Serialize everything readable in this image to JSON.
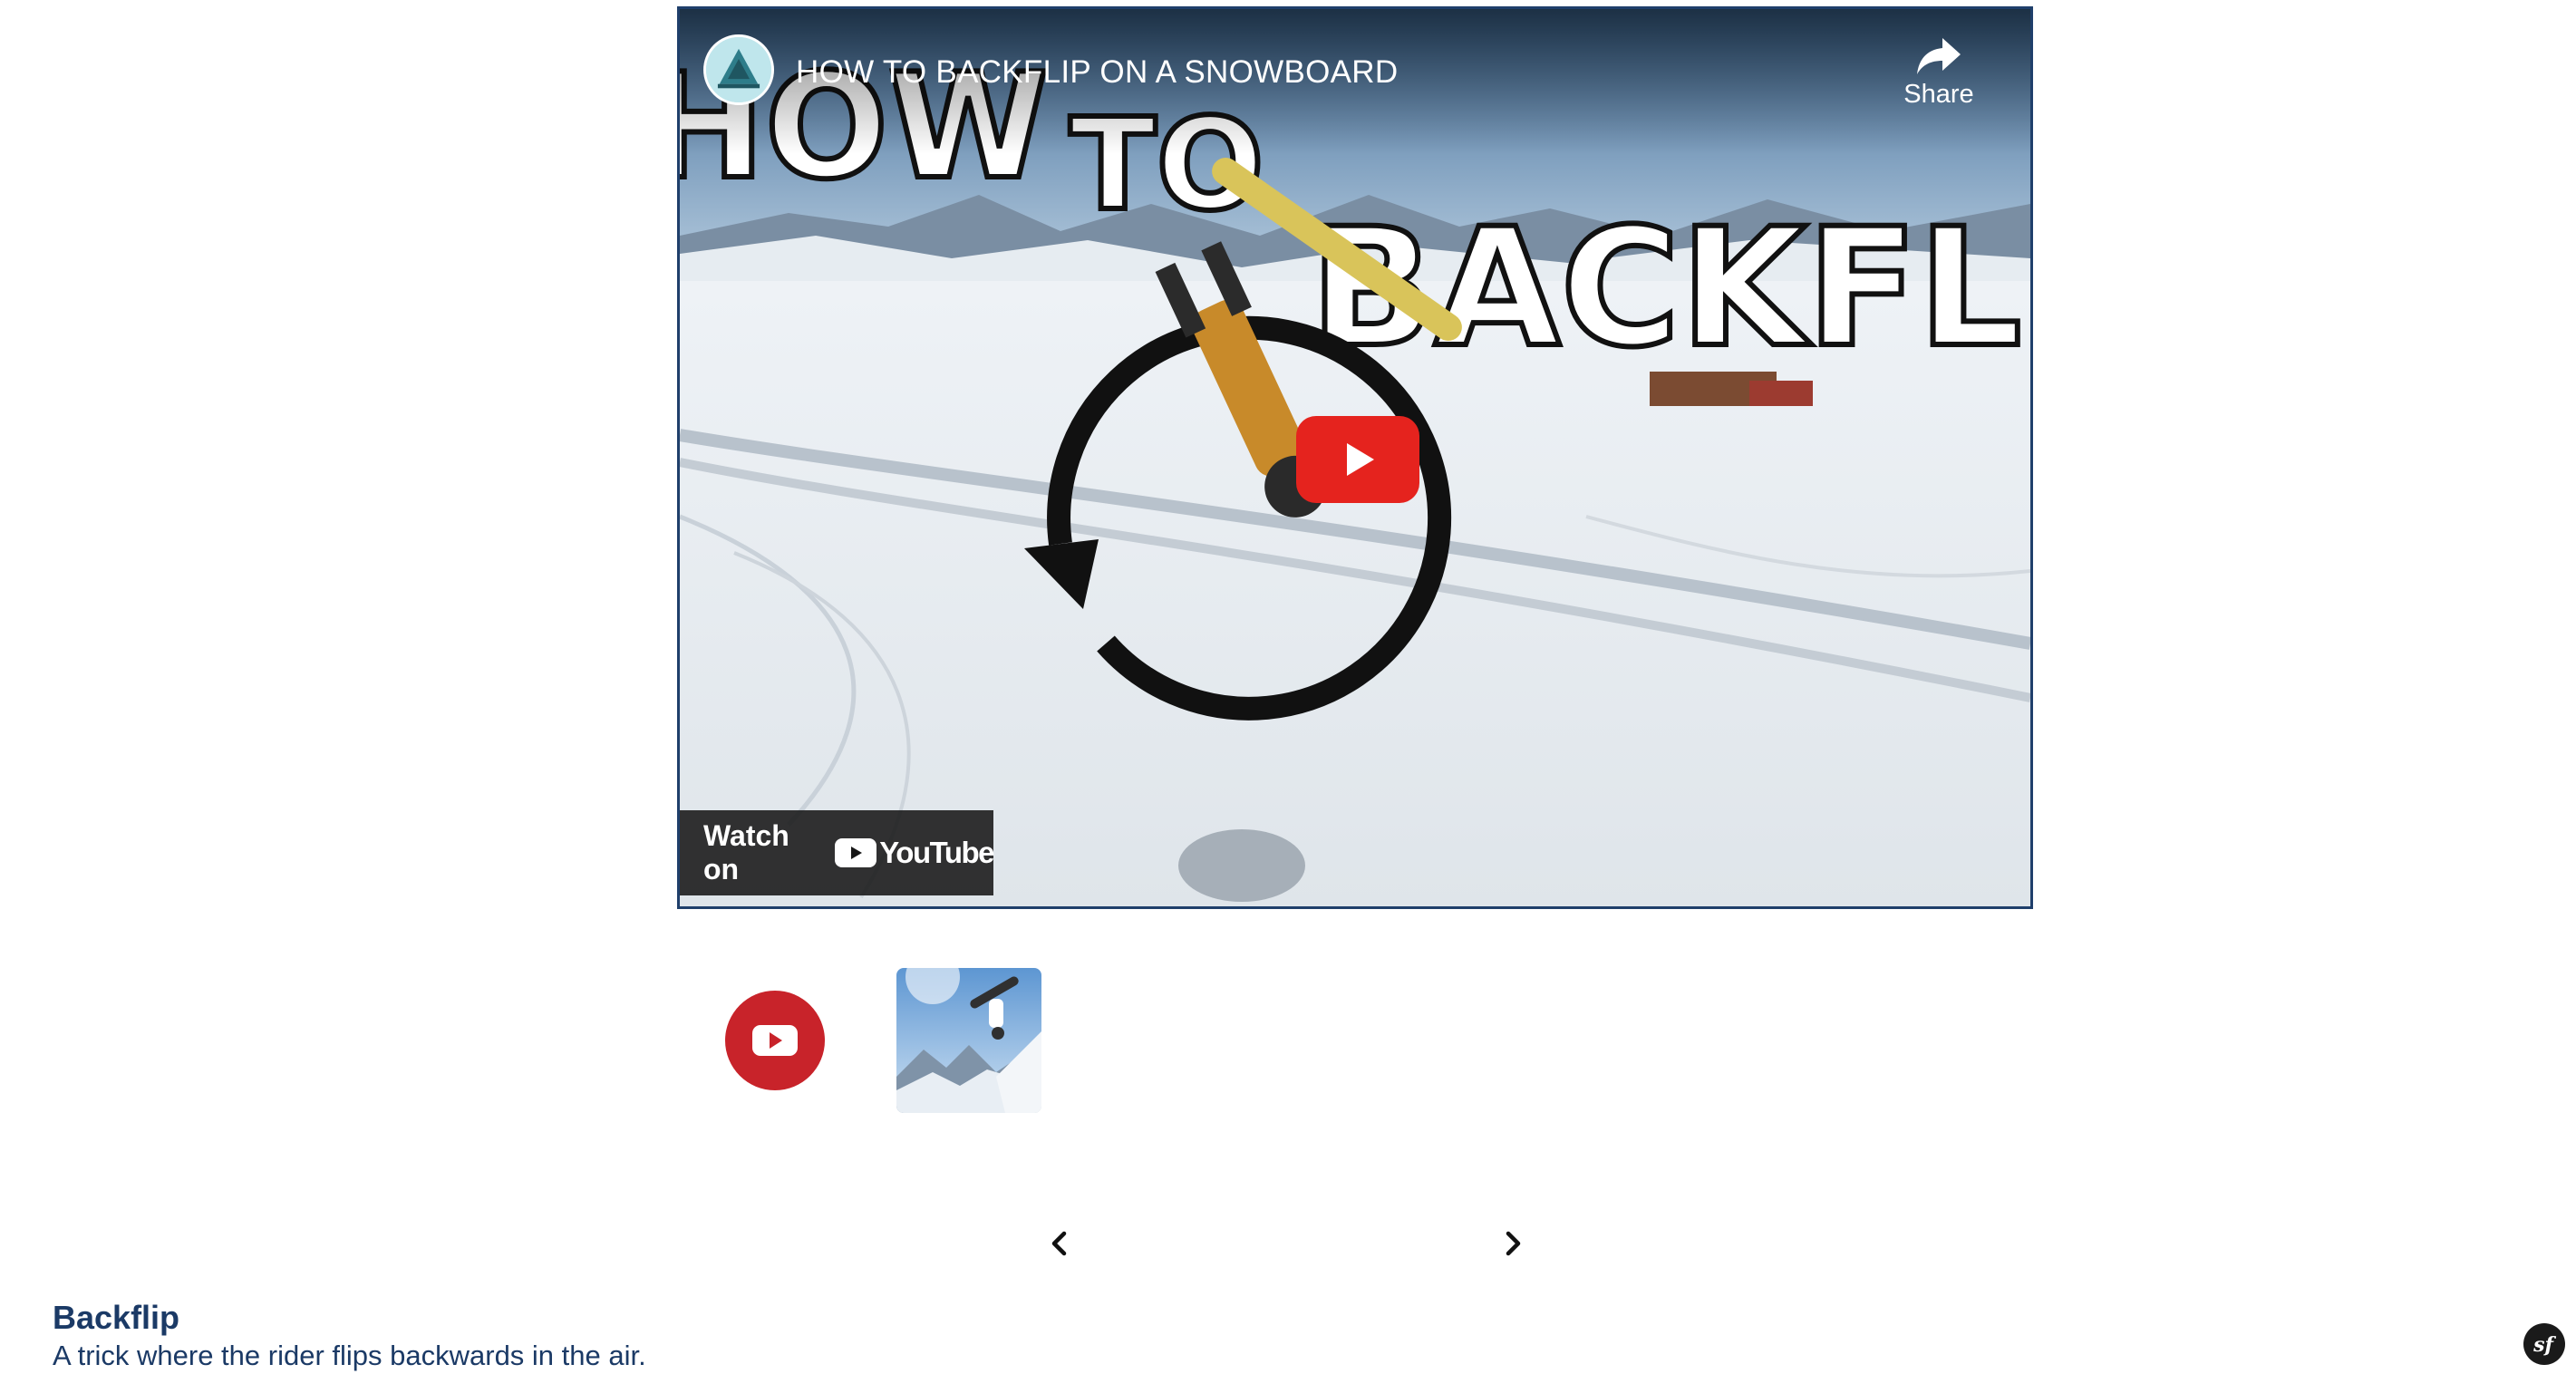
{
  "video": {
    "title": "HOW TO BACKFLIP ON A SNOWBOARD",
    "share_label": "Share",
    "watch_on_label": "Watch on",
    "youtube_logo_text": "YouTube",
    "thumbnail_text": {
      "word1": "HOW",
      "word2": "TO",
      "word3": "BACKFLIP"
    }
  },
  "media": {
    "items": [
      {
        "kind": "video",
        "icon": "youtube-icon"
      },
      {
        "kind": "image",
        "icon": "snowboard-photo"
      }
    ]
  },
  "carousel": {
    "prev_icon": "chevron-left-icon",
    "next_icon": "chevron-right-icon"
  },
  "trick": {
    "name": "Backflip",
    "description": "A trick where the rider flips backwards in the air."
  },
  "toolbar": {
    "badge_icon": "symfony-icon",
    "badge_text": "sf"
  },
  "colors": {
    "player_border": "#1f3f6b",
    "youtube_red": "#e5231e",
    "youtube_thumb_red": "#c8232a",
    "text_navy": "#1b3a66"
  }
}
